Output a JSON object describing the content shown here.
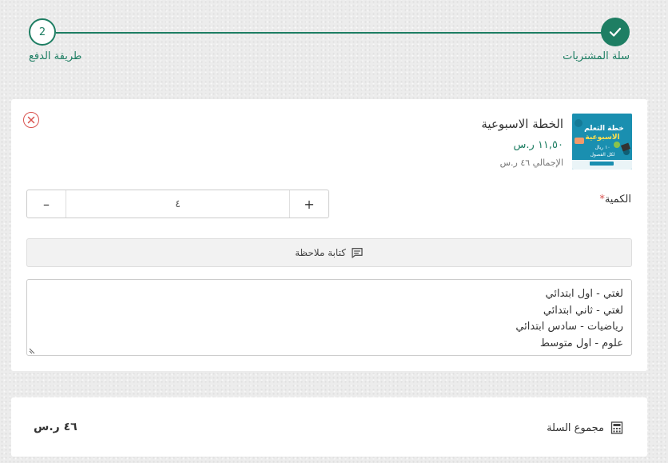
{
  "stepper": {
    "step1_label": "سلة المشتريات",
    "step2_number": "2",
    "step2_label": "طريقة الدفع"
  },
  "product": {
    "title": "الخطة الاسبوعية",
    "price": "١١,٥٠ ر.س",
    "total": "الإجمالي ٤٦ ر.س",
    "thumb": {
      "line1": "خطة التعلم",
      "line2": "الاسبوعية",
      "badge": "١٠ ريال",
      "line3": "لكل الفصول"
    }
  },
  "quantity": {
    "label": "الكمية",
    "required_mark": "*",
    "value": "٤",
    "minus": "–",
    "plus": "+"
  },
  "note": {
    "button_label": "كتابة ملاحظة",
    "text": "لغتي - اول ابتدائي\nلغتي - ثاني ابتدائي\nرياضيات - سادس ابتدائي\nعلوم - اول متوسط"
  },
  "summary": {
    "label": "مجموع السلة",
    "value": "٤٦ ر.س"
  },
  "colors": {
    "accent": "#1e7e63",
    "danger": "#d9534f"
  }
}
